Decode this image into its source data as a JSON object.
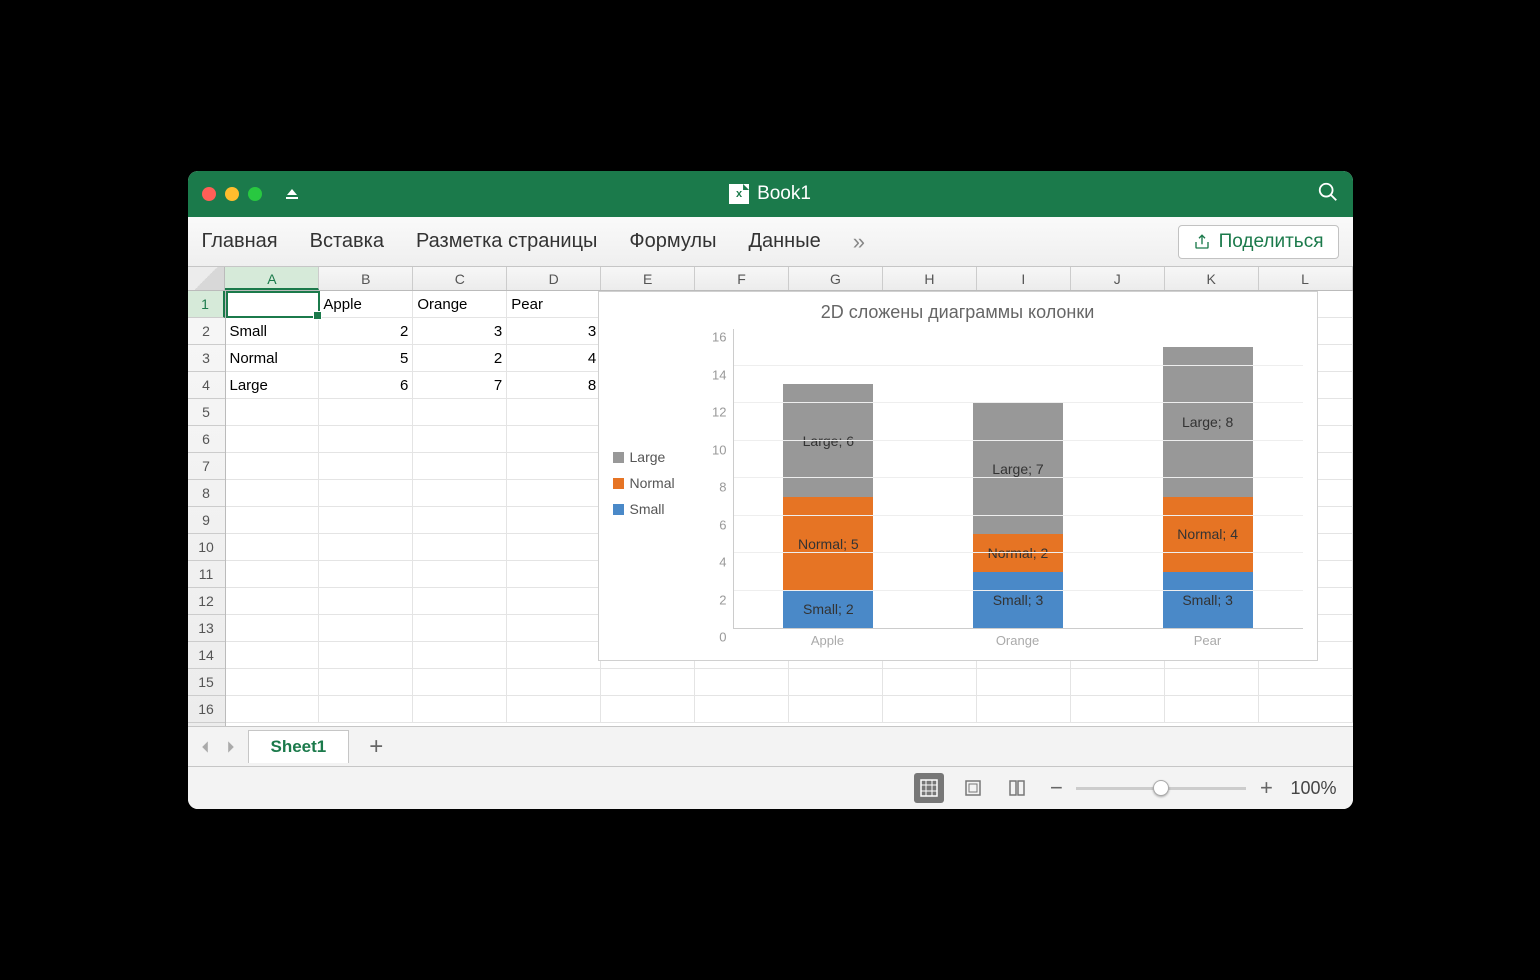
{
  "title": "Book1",
  "ribbon": {
    "tabs": [
      "Главная",
      "Вставка",
      "Разметка страницы",
      "Формулы",
      "Данные"
    ],
    "more": "»",
    "share": "Поделиться"
  },
  "columns": [
    "A",
    "B",
    "C",
    "D",
    "E",
    "F",
    "G",
    "H",
    "I",
    "J",
    "K",
    "L"
  ],
  "rows": [
    "1",
    "2",
    "3",
    "4",
    "5",
    "6",
    "7",
    "8",
    "9",
    "10",
    "11",
    "12",
    "13",
    "14",
    "15",
    "16"
  ],
  "active_col": "A",
  "active_row": "1",
  "data": {
    "B1": "Apple",
    "C1": "Orange",
    "D1": "Pear",
    "A2": "Small",
    "B2": "2",
    "C2": "3",
    "D2": "3",
    "A3": "Normal",
    "B3": "5",
    "C3": "2",
    "D3": "4",
    "A4": "Large",
    "B4": "6",
    "C4": "7",
    "D4": "8"
  },
  "chart": {
    "title": "2D сложены диаграммы колонки",
    "legend": [
      {
        "name": "Large",
        "color": "#989898"
      },
      {
        "name": "Normal",
        "color": "#e67424"
      },
      {
        "name": "Small",
        "color": "#4a89c8"
      }
    ],
    "ymax": 16,
    "yticks": [
      "16",
      "14",
      "12",
      "10",
      "8",
      "6",
      "4",
      "2",
      "0"
    ]
  },
  "chart_data": {
    "type": "bar",
    "stacked": true,
    "title": "2D сложены диаграммы колонки",
    "categories": [
      "Apple",
      "Orange",
      "Pear"
    ],
    "series": [
      {
        "name": "Small",
        "values": [
          2,
          3,
          3
        ],
        "color": "#4a89c8"
      },
      {
        "name": "Normal",
        "values": [
          5,
          2,
          4
        ],
        "color": "#e67424"
      },
      {
        "name": "Large",
        "values": [
          6,
          7,
          8
        ],
        "color": "#989898"
      }
    ],
    "data_labels": [
      [
        "Small; 2",
        "Small; 3",
        "Small; 3"
      ],
      [
        "Normal; 5",
        "Normal; 2",
        "Normal; 4"
      ],
      [
        "Large; 6",
        "Large; 7",
        "Large; 8"
      ]
    ],
    "ylim": [
      0,
      16
    ]
  },
  "sheet_tabs": {
    "active": "Sheet1"
  },
  "statusbar": {
    "zoom": "100%"
  }
}
